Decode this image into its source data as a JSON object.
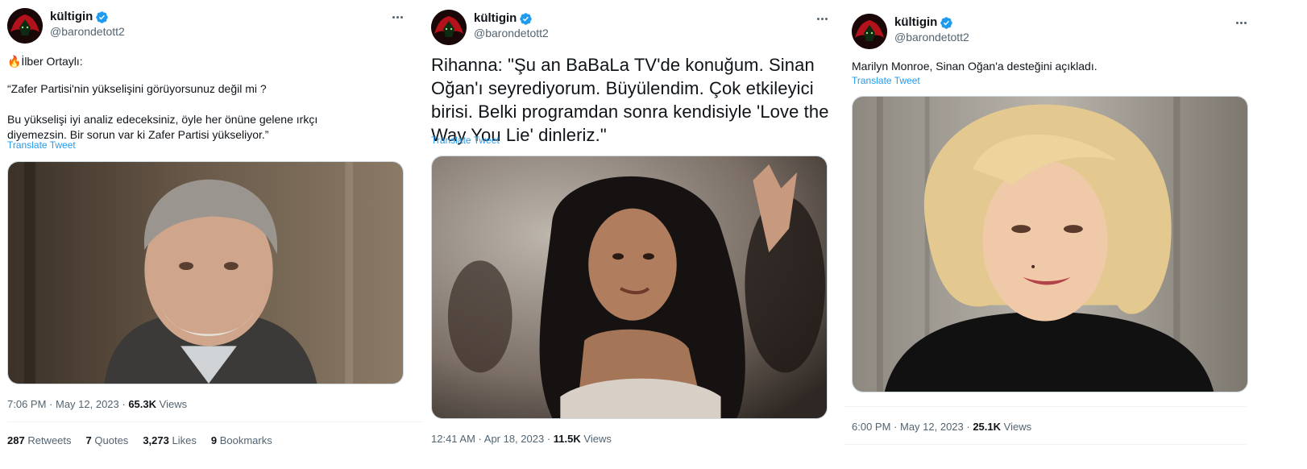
{
  "tweets": [
    {
      "author": {
        "name": "kültigin",
        "handle": "@barondetott2"
      },
      "intro": "🔥İlber Ortaylı:",
      "body": "“Zafer Partisi'nin yükselişini görüyorsunuz değil mi ?\n\nBu yükselişi iyi analiz edeceksiniz, öyle her önüne gelene ırkçı diyemezsin. Bir sorun var ki Zafer Partisi yükseliyor.”",
      "translate_label": "Translate Tweet",
      "time": "7:06 PM",
      "date": "May 12, 2023",
      "views_count": "65.3K",
      "views_label": "Views",
      "stats": {
        "retweets_count": "287",
        "retweets_label": "Retweets",
        "quotes_count": "7",
        "quotes_label": "Quotes",
        "likes_count": "3,273",
        "likes_label": "Likes",
        "bookmarks_count": "9",
        "bookmarks_label": "Bookmarks"
      }
    },
    {
      "author": {
        "name": "kültigin",
        "handle": "@barondetott2"
      },
      "body": "Rihanna: \"Şu an BaBaLa TV'de konuğum. Sinan Oğan'ı seyrediyorum. Büyülendim. Çok etkileyici birisi. Belki programdan sonra kendisiyle 'Love the Way You Lie' dinleriz.\"",
      "translate_label": "Translate Tweet",
      "time": "12:41 AM",
      "date": "Apr 18, 2023",
      "views_count": "11.5K",
      "views_label": "Views"
    },
    {
      "author": {
        "name": "kültigin",
        "handle": "@barondetott2"
      },
      "body": "Marilyn Monroe, Sinan Oğan'a desteğini açıkladı.",
      "translate_label": "Translate Tweet",
      "time": "6:00 PM",
      "date": "May 12, 2023",
      "views_count": "25.1K",
      "views_label": "Views"
    }
  ],
  "colors": {
    "accent": "#1d9bf0",
    "text_primary": "#0f1419",
    "text_secondary": "#536471",
    "border": "#eff3f4"
  },
  "icons": [
    "wolf-avatar-icon",
    "verified-badge-icon",
    "more-options-icon"
  ]
}
